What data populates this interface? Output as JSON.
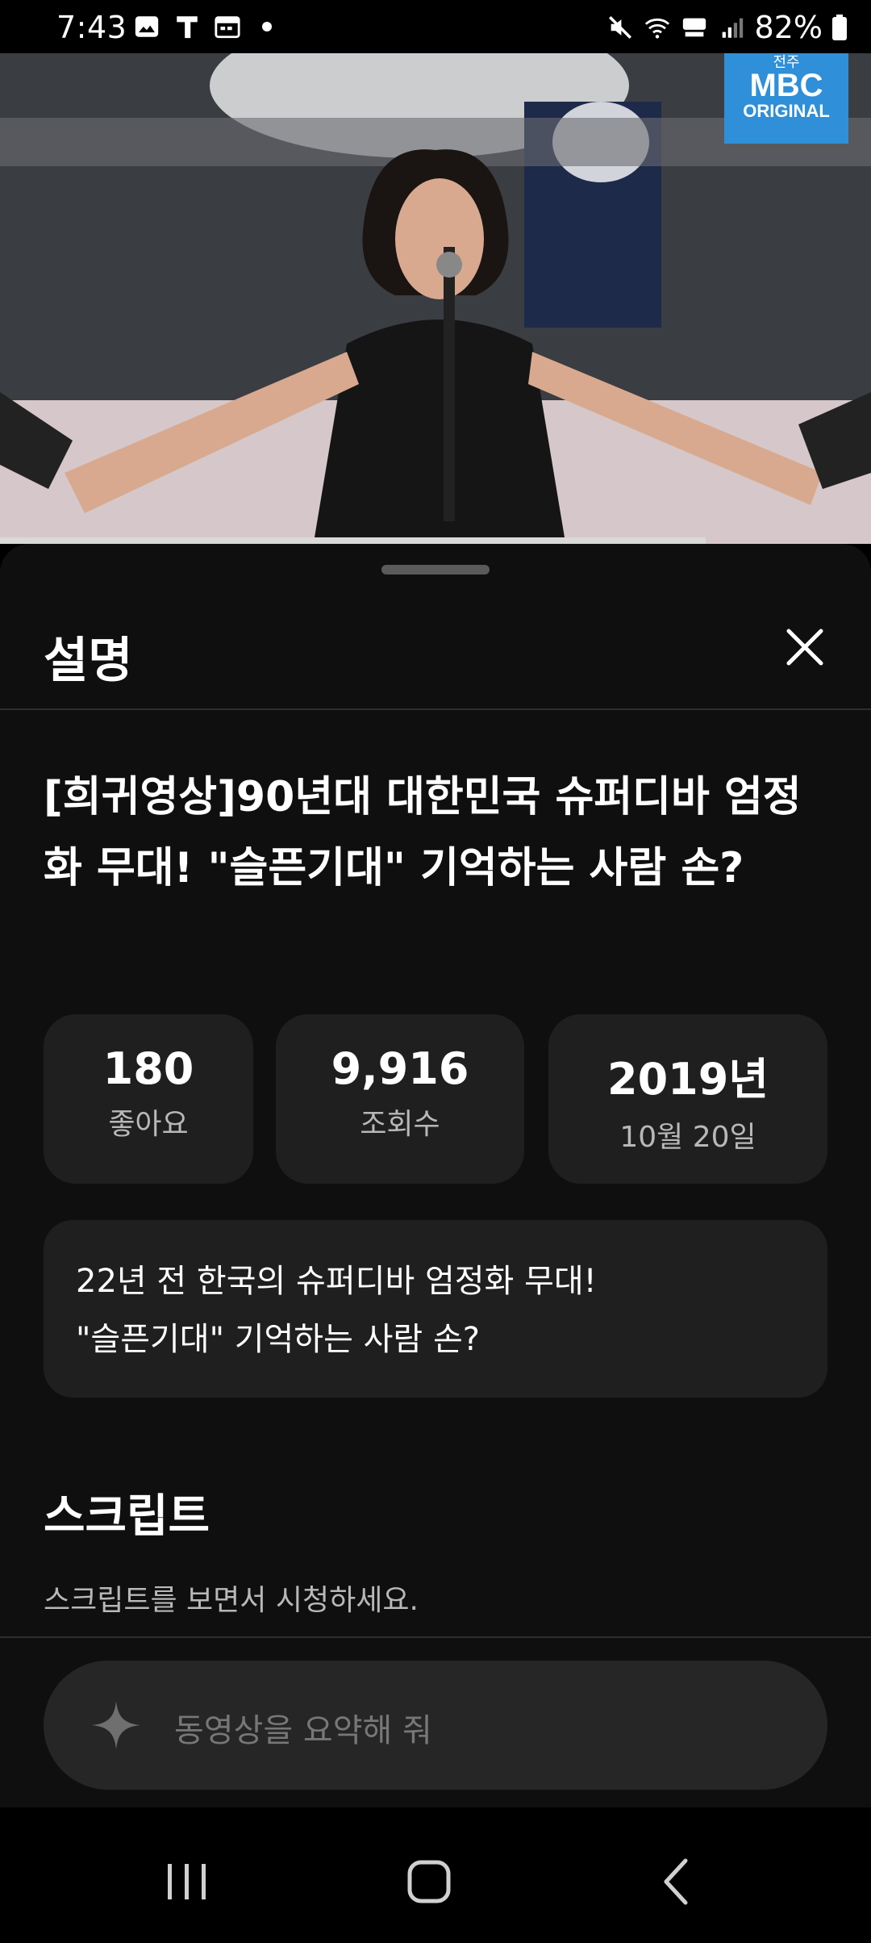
{
  "status_bar": {
    "time": "7:43",
    "battery": "82%"
  },
  "video": {
    "channel_logo_small": "전주",
    "channel_logo_main": "MBC",
    "channel_logo_sub": "ORIGINAL",
    "progress": 0.81
  },
  "sheet": {
    "title": "설명",
    "video_title": "[희귀영상]90년대 대한민국 슈퍼디바 엄정화 무대! \"슬픈기대\" 기억하는 사람 손?",
    "stats": [
      {
        "value": "180",
        "label": "좋아요"
      },
      {
        "value": "9,916",
        "label": "조회수"
      },
      {
        "value": "2019년",
        "label": "10월 20일"
      }
    ],
    "description": "22년 전 한국의 슈퍼디바 엄정화 무대!\n \"슬픈기대\" 기억하는 사람 손?",
    "script_title": "스크립트",
    "script_subtitle": "스크립트를 보면서 시청하세요.",
    "ask_placeholder": "동영상을 요약해 줘"
  },
  "nav": {
    "recents": "recents-icon",
    "home": "home-icon",
    "back": "back-icon"
  },
  "colors": {
    "sheet_bg": "#0f0f0f",
    "card_bg": "#1f1f1f",
    "mbc_blue": "#2f8fd8"
  }
}
